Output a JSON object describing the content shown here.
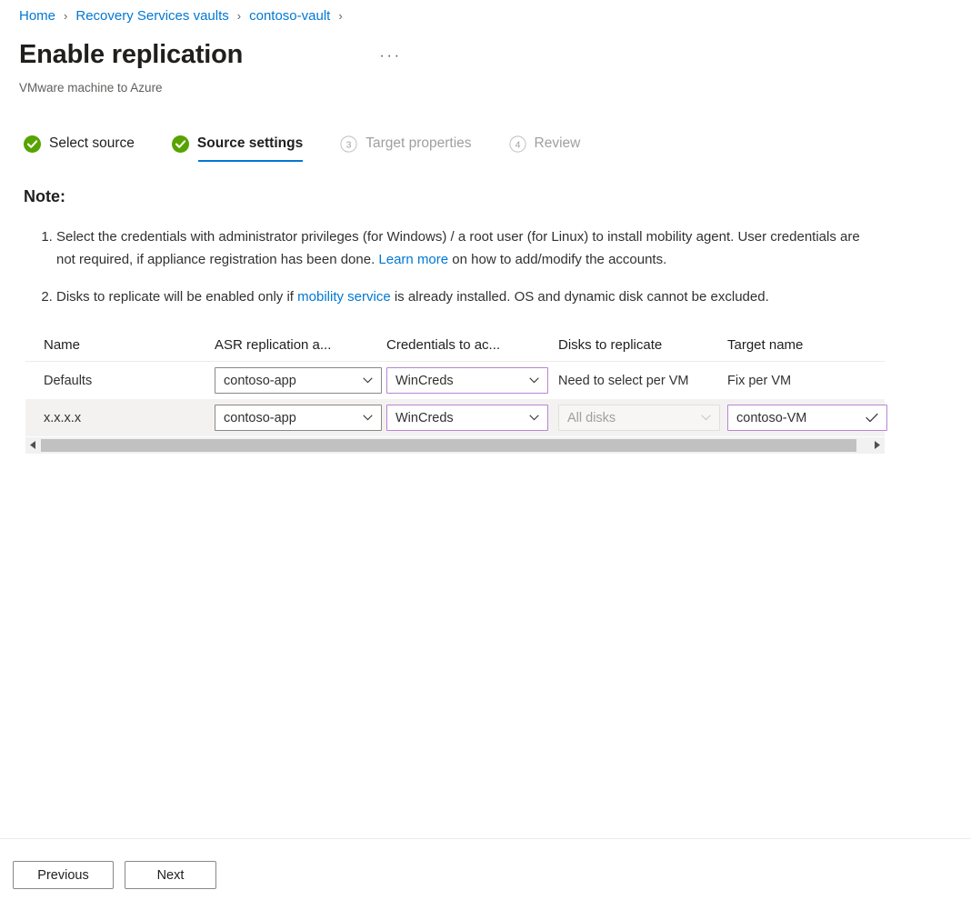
{
  "breadcrumb": {
    "items": [
      {
        "label": "Home"
      },
      {
        "label": "Recovery Services vaults"
      },
      {
        "label": "contoso-vault"
      }
    ],
    "separator": "›"
  },
  "header": {
    "title": "Enable replication",
    "subtitle": "VMware machine to Azure",
    "more_menu": "···"
  },
  "steps": [
    {
      "label": "Select source",
      "state": "complete",
      "number": "1"
    },
    {
      "label": "Source settings",
      "state": "active",
      "number": "2"
    },
    {
      "label": "Target properties",
      "state": "pending",
      "number": "3"
    },
    {
      "label": "Review",
      "state": "pending",
      "number": "4"
    }
  ],
  "note": {
    "heading": "Note:",
    "item1_part1": "Select the credentials with administrator privileges (for Windows) / a root user (for Linux) to install mobility agent. User credentials are not required, if appliance registration has been done. ",
    "item1_link": "Learn more",
    "item1_part2": " on how to add/modify the accounts.",
    "item2_part1": "Disks to replicate will be enabled only if ",
    "item2_link": "mobility service",
    "item2_part2": " is already installed. OS and dynamic disk cannot be excluded."
  },
  "table": {
    "columns": [
      "Name",
      "ASR replication a...",
      "Credentials to ac...",
      "Disks to replicate",
      "Target name"
    ],
    "rows": [
      {
        "name": "Defaults",
        "asr_policy": "contoso-app",
        "credentials": "WinCreds",
        "disks": "Need to select per VM",
        "target_name": "Fix per VM"
      },
      {
        "name": "x.x.x.x",
        "asr_policy": "contoso-app",
        "credentials": "WinCreds",
        "disks": "All disks",
        "target_name": "contoso-VM"
      }
    ]
  },
  "footer": {
    "previous": "Previous",
    "next": "Next"
  },
  "colors": {
    "link": "#0078d4",
    "accent_underline": "#0078d4",
    "step_complete": "#57a300",
    "step_pending": "#a19f9d",
    "field_accent_border": "#b984d4",
    "row_alt_background": "#f3f2f1"
  }
}
